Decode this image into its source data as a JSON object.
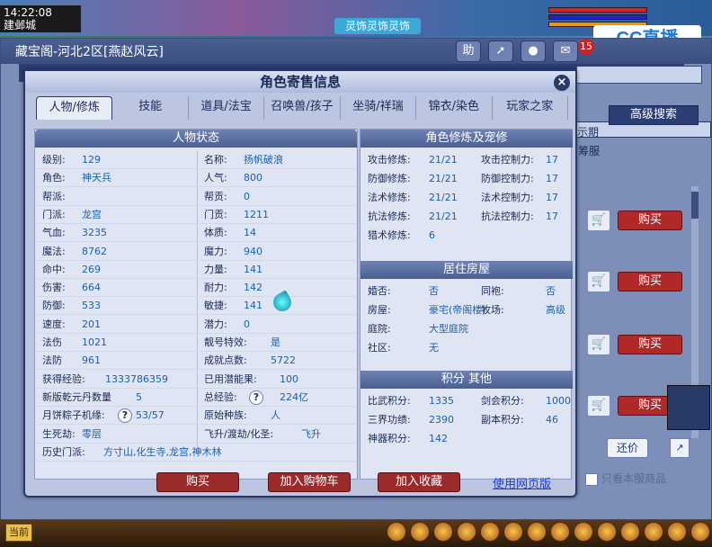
{
  "hud": {
    "time": "14:22:08",
    "location": "建邺城",
    "banner": "灵饰灵饰灵饰",
    "badge_count": "15",
    "cc_logo": "CC直播",
    "bottom_btn": "当前"
  },
  "bg_window": {
    "title": "藏宝阁-河北2区[燕赵风云]",
    "help": "助",
    "period_label": "示期",
    "shop_label": "筹服",
    "advanced_search": "高级搜索",
    "buy_label": "购买",
    "counteroffer": "还价",
    "only_this_server": "只看本服商品"
  },
  "dialog": {
    "title": "角色寄售信息",
    "tabs": [
      "人物/修炼",
      "技能",
      "道具/法宝",
      "召唤兽/孩子",
      "坐骑/祥瑞",
      "锦衣/染色",
      "玩家之家"
    ],
    "status": {
      "header": "人物状态",
      "left": [
        {
          "k": "级别:",
          "v": "129"
        },
        {
          "k": "角色:",
          "v": "神天兵"
        },
        {
          "k": "帮派:",
          "v": ""
        },
        {
          "k": "门派:",
          "v": "龙宫"
        },
        {
          "k": "气血:",
          "v": "3235"
        },
        {
          "k": "魔法:",
          "v": "8762"
        },
        {
          "k": "命中:",
          "v": "269"
        },
        {
          "k": "伤害:",
          "v": "664"
        },
        {
          "k": "防御:",
          "v": "533"
        },
        {
          "k": "速度:",
          "v": "201"
        },
        {
          "k": "法伤",
          "v": "1021"
        },
        {
          "k": "法防",
          "v": "961"
        },
        {
          "k": "获得经验:",
          "v": "1333786359"
        },
        {
          "k": "新版乾元丹数量",
          "v": "5"
        },
        {
          "k": "月饼粽子机缘:",
          "v": "53/57"
        },
        {
          "k": "生死劫:",
          "v": "零层"
        },
        {
          "k": "历史门派:",
          "v": "方寸山,化生寺,龙宫,神木林"
        }
      ],
      "right": [
        {
          "k": "名称:",
          "v": "扬帆破浪"
        },
        {
          "k": "人气:",
          "v": "800"
        },
        {
          "k": "帮贡:",
          "v": "0"
        },
        {
          "k": "门贡:",
          "v": "1211"
        },
        {
          "k": "体质:",
          "v": "14"
        },
        {
          "k": "魔力:",
          "v": "940"
        },
        {
          "k": "力量:",
          "v": "141"
        },
        {
          "k": "耐力:",
          "v": "142"
        },
        {
          "k": "敏捷:",
          "v": "141"
        },
        {
          "k": "潜力:",
          "v": "0"
        },
        {
          "k": "靓号特效:",
          "v": "是"
        },
        {
          "k": "成就点数:",
          "v": "5722"
        },
        {
          "k": "已用潜能果:",
          "v": "100"
        },
        {
          "k": "总经验:",
          "v": "224亿"
        },
        {
          "k": "原始种族:",
          "v": "人"
        },
        {
          "k": "飞升/渡劫/化圣:",
          "v": "飞升"
        }
      ]
    },
    "cultivation": {
      "header": "角色修炼及宠修",
      "rows": [
        {
          "k1": "攻击修炼:",
          "v1": "21/21",
          "k2": "攻击控制力:",
          "v2": "17"
        },
        {
          "k1": "防御修炼:",
          "v1": "21/21",
          "k2": "防御控制力:",
          "v2": "17"
        },
        {
          "k1": "法术修炼:",
          "v1": "21/21",
          "k2": "法术控制力:",
          "v2": "17"
        },
        {
          "k1": "抗法修炼:",
          "v1": "21/21",
          "k2": "抗法控制力:",
          "v2": "17"
        },
        {
          "k1": "猎术修炼:",
          "v1": "6",
          "k2": "",
          "v2": ""
        }
      ]
    },
    "housing": {
      "header": "居住房屋",
      "rows": [
        {
          "k1": "婚否:",
          "v1": "否",
          "k2": "同袍:",
          "v2": "否"
        },
        {
          "k1": "房屋:",
          "v1": "豪宅(帝阁楼)",
          "k2": "牧场:",
          "v2": "高级"
        },
        {
          "k1": "庭院:",
          "v1": "大型庭院",
          "k2": "",
          "v2": ""
        },
        {
          "k1": "社区:",
          "v1": "无",
          "k2": "",
          "v2": ""
        }
      ]
    },
    "points": {
      "header": "积分 其他",
      "rows": [
        {
          "k1": "比武积分:",
          "v1": "1335",
          "k2": "剑会积分:",
          "v2": "1000"
        },
        {
          "k1": "三界功绩:",
          "v1": "2390",
          "k2": "副本积分:",
          "v2": "46"
        },
        {
          "k1": "神器积分:",
          "v1": "142",
          "k2": "",
          "v2": ""
        }
      ]
    },
    "actions": {
      "buy": "购买",
      "add_cart": "加入购物车",
      "add_fav": "加入收藏",
      "web_link": "使用网页版"
    }
  }
}
